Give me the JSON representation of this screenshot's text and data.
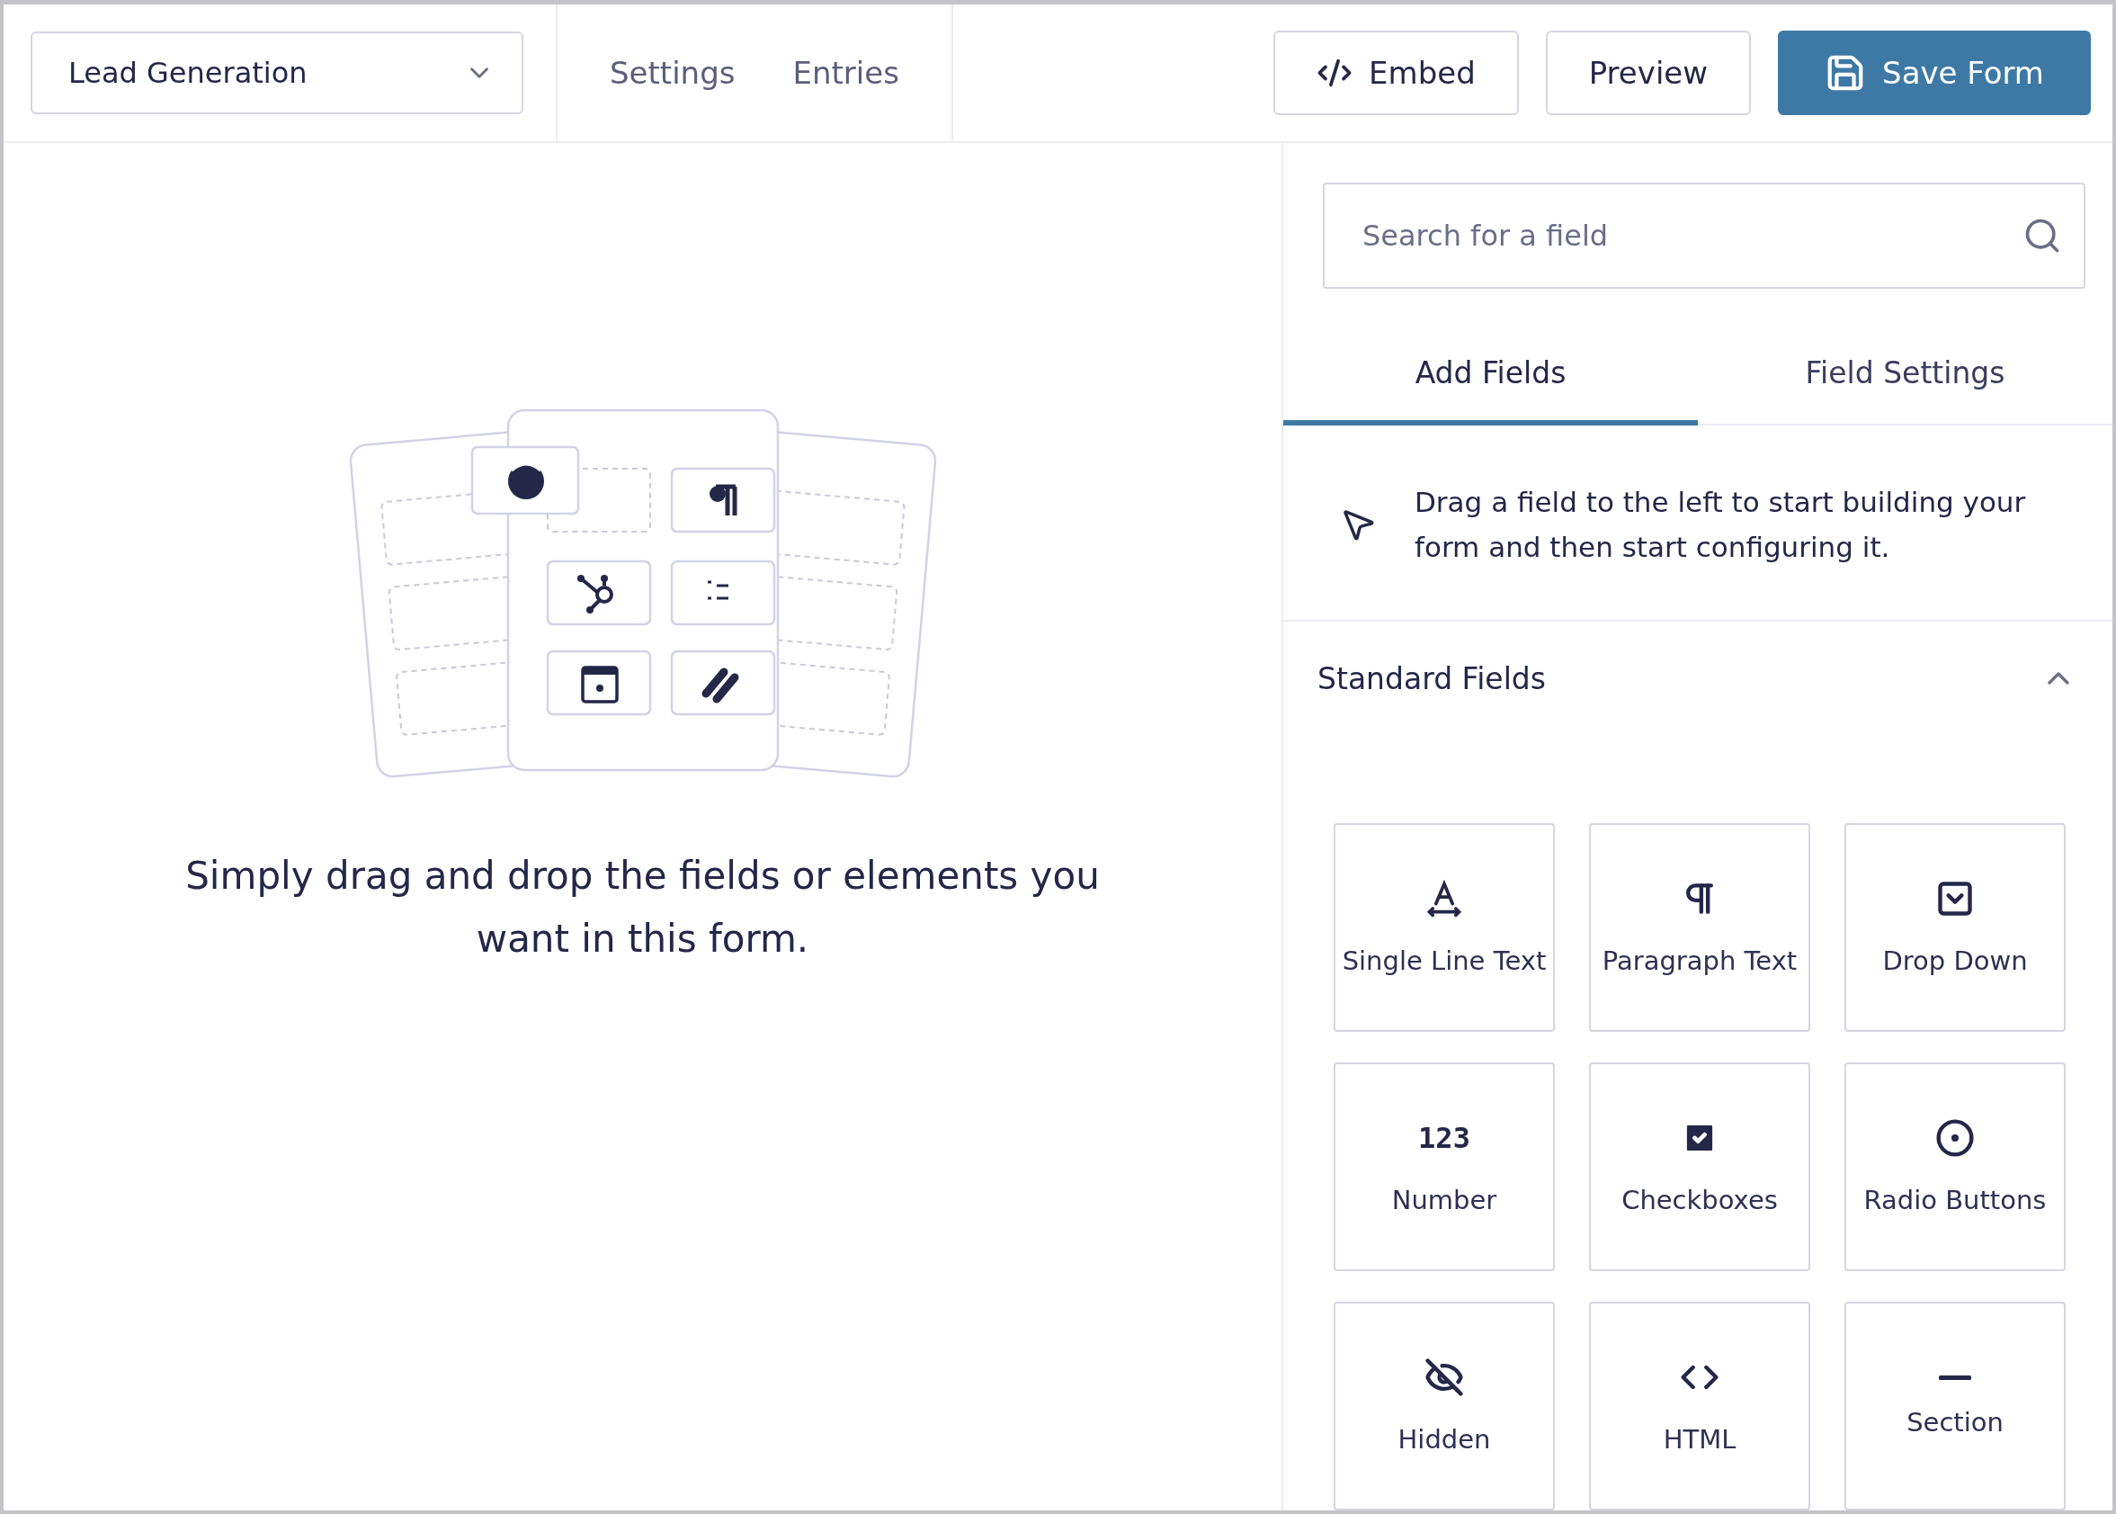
{
  "header": {
    "form_select": {
      "value": "Lead Generation"
    },
    "nav": [
      {
        "label": "Settings"
      },
      {
        "label": "Entries"
      }
    ],
    "buttons": [
      {
        "kind": "embed",
        "label": "Embed"
      },
      {
        "kind": "preview",
        "label": "Preview"
      },
      {
        "kind": "save",
        "label": "Save Form"
      }
    ]
  },
  "canvas": {
    "message": "Simply drag and drop the fields or elements you want in this form."
  },
  "sidebar": {
    "search": {
      "placeholder": "Search for a field"
    },
    "tabs": [
      {
        "label": "Add Fields",
        "selected": true
      },
      {
        "label": "Field Settings",
        "selected": false
      }
    ],
    "hint": "Drag a field to the left to start building your form and then start configuring it.",
    "section": {
      "title": "Standard Fields",
      "expanded": true,
      "fields": [
        {
          "kind": "single-line",
          "label": "Single Line Text"
        },
        {
          "kind": "paragraph",
          "label": "Paragraph Text"
        },
        {
          "kind": "dropdown",
          "label": "Drop Down"
        },
        {
          "kind": "number",
          "label": "Number",
          "icon_text": "123"
        },
        {
          "kind": "checkbox",
          "label": "Checkboxes"
        },
        {
          "kind": "radio",
          "label": "Radio Buttons"
        },
        {
          "kind": "hidden",
          "label": "Hidden"
        },
        {
          "kind": "html",
          "label": "HTML"
        },
        {
          "kind": "section",
          "label": "Section"
        }
      ]
    }
  }
}
